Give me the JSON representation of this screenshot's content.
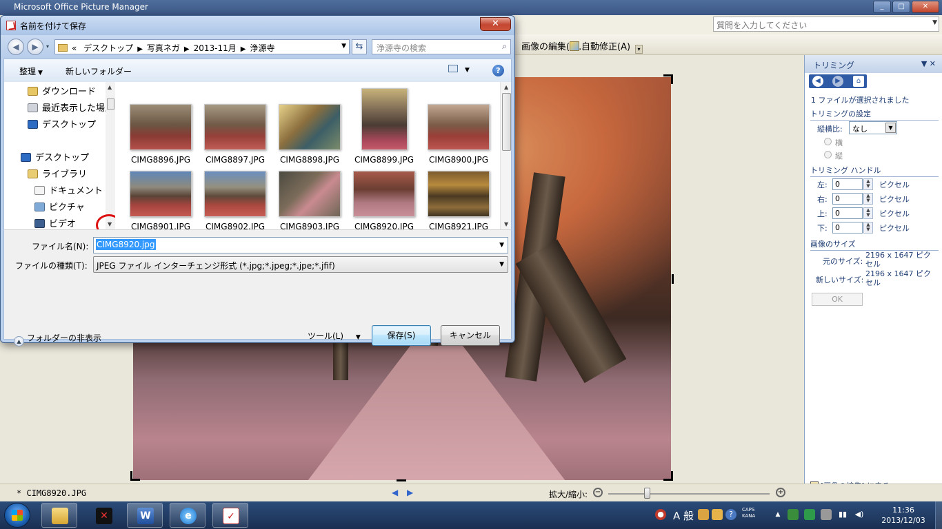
{
  "app": {
    "title": "Microsoft Office Picture Manager",
    "help_placeholder": "質問を入力してください",
    "toolbar": {
      "edit_picture": "画像の編集(I)...",
      "auto_correct": "自動修正(A)"
    }
  },
  "dialog": {
    "title": "名前を付けて保存",
    "breadcrumb": [
      "«",
      "デスクトップ",
      "写真ネガ",
      "2013-11月",
      "浄源寺"
    ],
    "search_placeholder": "浄源寺の検索",
    "organize_label": "整理",
    "new_folder_label": "新しいフォルダー",
    "nav_items": [
      {
        "label": "ダウンロード"
      },
      {
        "label": "最近表示した場所"
      },
      {
        "label": "デスクトップ"
      },
      {
        "label": "デスクトップ"
      },
      {
        "label": "ライブラリ"
      },
      {
        "label": "ドキュメント"
      },
      {
        "label": "ピクチャ"
      },
      {
        "label": "ビデオ"
      }
    ],
    "files": [
      {
        "name": "CIMG8896.JPG"
      },
      {
        "name": "CIMG8897.JPG"
      },
      {
        "name": "CIMG8898.JPG"
      },
      {
        "name": "CIMG8899.JPG"
      },
      {
        "name": "CIMG8900.JPG"
      },
      {
        "name": "CIMG8901.JPG"
      },
      {
        "name": "CIMG8902.JPG"
      },
      {
        "name": "CIMG8903.JPG"
      },
      {
        "name": "CIMG8920.JPG"
      },
      {
        "name": "CIMG8921.JPG"
      }
    ],
    "filename_label": "ファイル名(N):",
    "filename_value": "CIMG8920.jpg",
    "filetype_label": "ファイルの種類(T):",
    "filetype_value": "JPEG ファイル インターチェンジ形式 (*.jpg;*.jpeg;*.jpe;*.jfif)",
    "hide_folders_label": "フォルダーの非表示",
    "tools_label": "ツール(L)",
    "save_label": "保存(S)",
    "cancel_label": "キャンセル"
  },
  "taskpane": {
    "title": "トリミング",
    "selected_text": "1 ファイルが選択されました",
    "crop_settings_heading": "トリミングの設定",
    "aspect_label": "縦横比:",
    "aspect_value": "なし",
    "orientation_landscape": "横",
    "orientation_portrait": "縦",
    "handles_heading": "トリミング ハンドル",
    "handles": [
      {
        "label": "左:",
        "value": "0",
        "unit": "ピクセル"
      },
      {
        "label": "右:",
        "value": "0",
        "unit": "ピクセル"
      },
      {
        "label": "上:",
        "value": "0",
        "unit": "ピクセル"
      },
      {
        "label": "下:",
        "value": "0",
        "unit": "ピクセル"
      }
    ],
    "image_size_heading": "画像のサイズ",
    "original_size_label": "元のサイズ:",
    "original_size_value": "2196 x 1647 ピクセル",
    "new_size_label": "新しいサイズ:",
    "new_size_value": "2196 x 1647 ピクセル",
    "ok_label": "OK",
    "back_link": "[画像の編集] に戻る"
  },
  "statusbar": {
    "file_name": "* CIMG8920.JPG",
    "zoom_label": "拡大/縮小:",
    "zoom_level": 0.24
  },
  "taskbar": {
    "ime_mode": "A 般",
    "caps_text": "CAPS",
    "kana_text": "KANA",
    "clock_time": "11:36",
    "clock_date": "2013/12/03"
  },
  "colors": {
    "dialog_frame": "#bcd2ee",
    "selection": "#3399ff",
    "highlight_ring": "#dd1111",
    "taskpane_text": "#1f3e74"
  }
}
